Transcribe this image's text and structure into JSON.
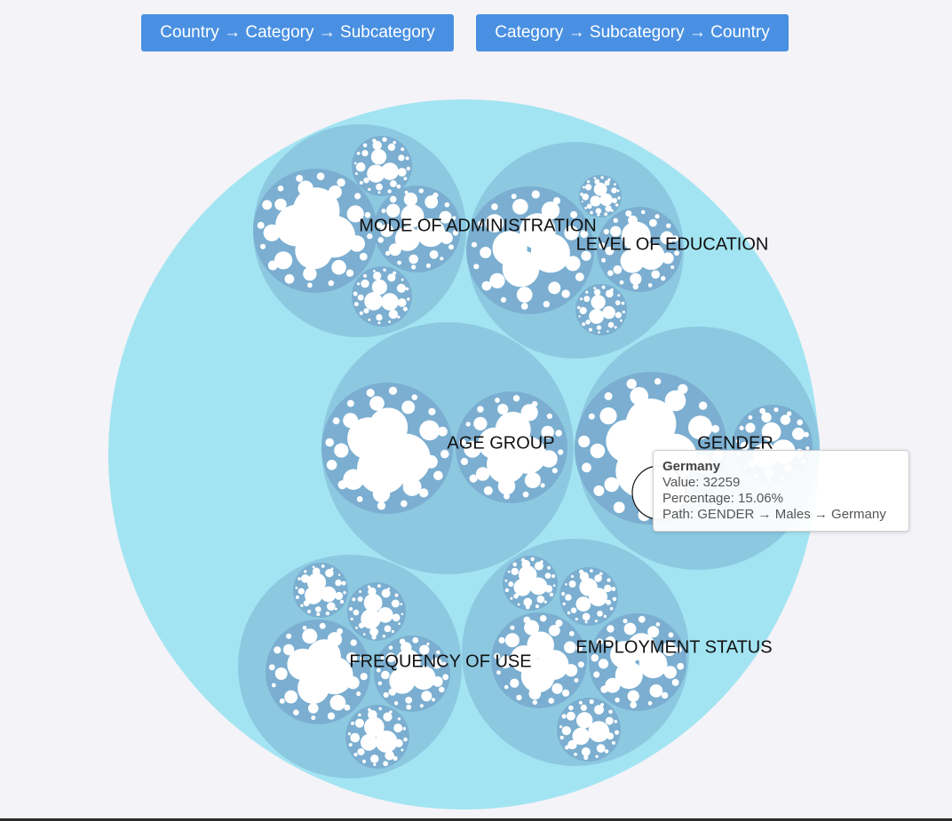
{
  "buttons": {
    "country_first": "Country → Category → Subcategory",
    "category_first": "Category → Subcategory → Country"
  },
  "colors": {
    "root": "#a3e4f2",
    "category": "#8cc9e1",
    "subcategory": "#7baed0",
    "leaf": "#ffffff",
    "button": "#4a90e2"
  },
  "chart_data": {
    "type": "circle-packing",
    "hierarchy": "Category → Subcategory → Country",
    "categories": [
      {
        "name": "MODE OF ADMINISTRATION"
      },
      {
        "name": "LEVEL OF EDUCATION"
      },
      {
        "name": "AGE GROUP"
      },
      {
        "name": "GENDER"
      },
      {
        "name": "FREQUENCY OF USE"
      },
      {
        "name": "EMPLOYMENT STATUS"
      }
    ],
    "highlighted": {
      "name": "Germany",
      "value_text": "Value: 32259",
      "percentage_text": "Percentage: 15.06%",
      "path_text": "Path: GENDER → Males → Germany",
      "value": 32259,
      "percentage": 15.06,
      "path": [
        "GENDER",
        "Males",
        "Germany"
      ]
    }
  },
  "tooltip": {
    "title": "Germany",
    "value": "Value: 32259",
    "percentage": "Percentage: 15.06%",
    "path": "Path: GENDER → Males → Germany"
  }
}
